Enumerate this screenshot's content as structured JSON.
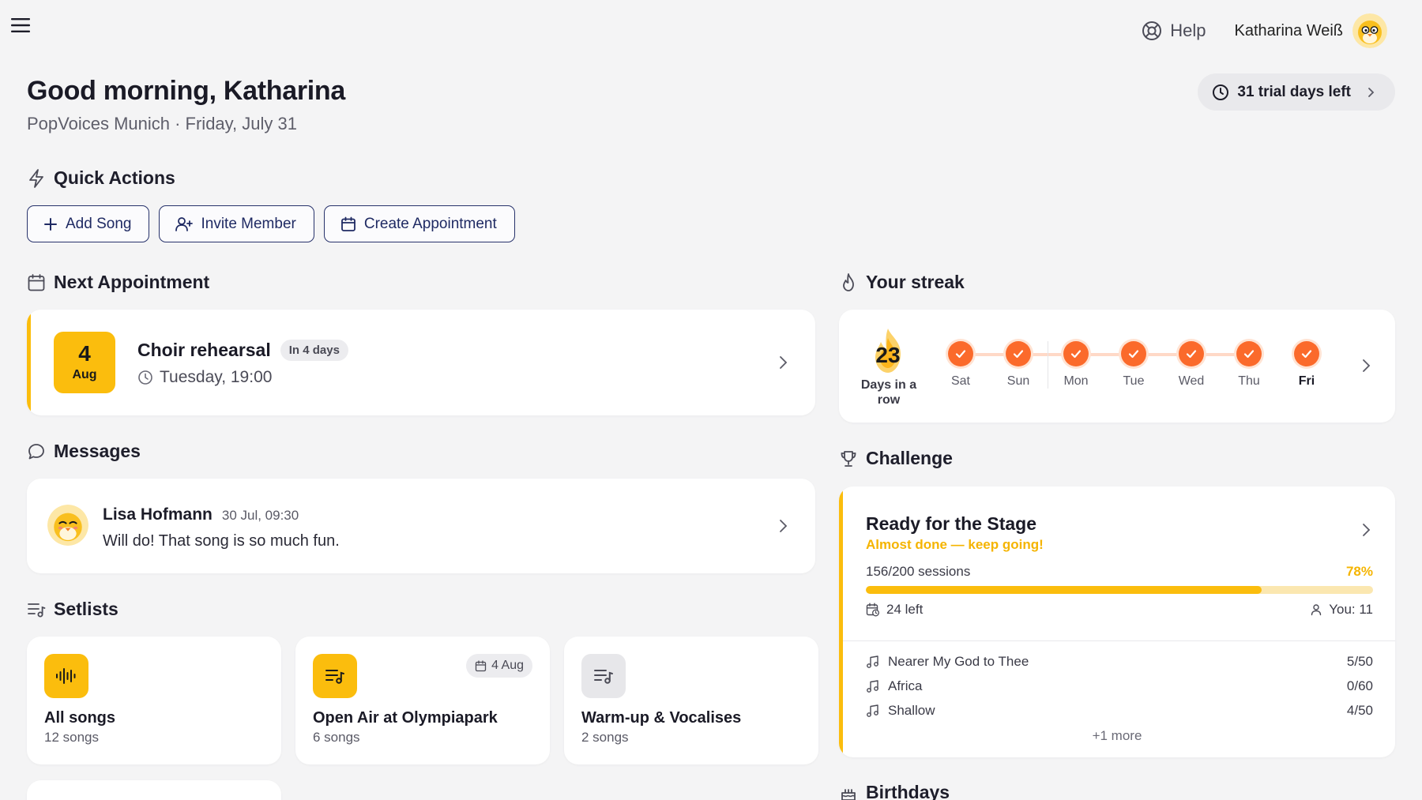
{
  "header": {
    "help_label": "Help",
    "user_name": "Katharina Weiß"
  },
  "greeting": {
    "title": "Good morning, Katharina",
    "subtitle": "PopVoices Munich · Friday, July 31",
    "trial_label": "31 trial days left"
  },
  "quick_actions": {
    "title": "Quick Actions",
    "buttons": [
      {
        "label": "Add Song",
        "icon": "plus-icon"
      },
      {
        "label": "Invite Member",
        "icon": "user-plus-icon"
      },
      {
        "label": "Create Appointment",
        "icon": "calendar-icon"
      }
    ]
  },
  "next_appointment": {
    "title": "Next Appointment",
    "day": "4",
    "month": "Aug",
    "name": "Choir rehearsal",
    "badge": "In 4 days",
    "time": "Tuesday, 19:00"
  },
  "messages": {
    "title": "Messages",
    "items": [
      {
        "sender": "Lisa Hofmann",
        "time": "30 Jul, 09:30",
        "text": "Will do! That song is so much fun."
      }
    ]
  },
  "setlists": {
    "title": "Setlists",
    "items": [
      {
        "name": "All songs",
        "count": "12 songs",
        "badge": ""
      },
      {
        "name": "Open Air at Olympiapark",
        "count": "6 songs",
        "badge": "4 Aug"
      },
      {
        "name": "Warm-up & Vocalises",
        "count": "2 songs",
        "badge": ""
      }
    ]
  },
  "streak": {
    "title": "Your streak",
    "count": "23",
    "label": "Days in a row",
    "days": [
      "Sat",
      "Sun",
      "Mon",
      "Tue",
      "Wed",
      "Thu",
      "Fri"
    ],
    "today": "Fri"
  },
  "challenge": {
    "title": "Challenge",
    "name": "Ready for the Stage",
    "subtitle": "Almost done — keep going!",
    "sessions": "156/200 sessions",
    "percent_label": "78%",
    "progress": 0.78,
    "left": "24 left",
    "you": "You: 11",
    "songs": [
      {
        "name": "Nearer My God to Thee",
        "score": "5/50"
      },
      {
        "name": "Africa",
        "score": "0/60"
      },
      {
        "name": "Shallow",
        "score": "4/50"
      }
    ],
    "more": "+1 more"
  },
  "birthdays": {
    "title": "Birthdays"
  },
  "colors": {
    "accent_yellow": "#fbbd0d",
    "streak_orange": "#fb6a2b",
    "button_navy": "#27326b",
    "background": "#f4f4f5"
  }
}
